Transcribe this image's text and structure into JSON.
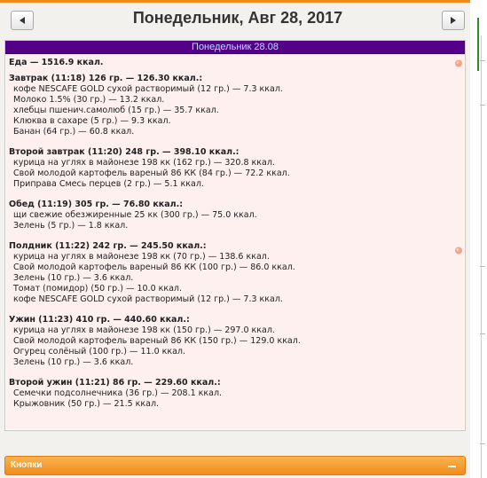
{
  "header": {
    "date_title": "Понедельник, Авг 28, 2017",
    "prev_symbol": "◄",
    "next_symbol": "►"
  },
  "day_header": "Понедельник 28.08",
  "food_total": "Еда — 1516.9 ккал.",
  "meals": [
    {
      "title": "Завтрак (11:18) 126 гр. — 126.30 ккал.:",
      "items": [
        "кофе NESCAFE GOLD сухой растворимый (12 гр.) — 7.3 ккал.",
        "Молоко 1.5% (30 гр.) — 13.2 ккал.",
        "хлебцы пшенич.самолюб (15 гр.) — 35.7 ккал.",
        "Клюква в сахаре (5 гр.) — 9.3 ккал.",
        "Банан (64 гр.) — 60.8 ккал."
      ]
    },
    {
      "title": "Второй завтрак (11:20) 248 гр. — 398.10 ккал.:",
      "items": [
        "курица на углях в майонезе 198 кк (162 гр.) — 320.8 ккал.",
        "Свой молодой картофель вареный 86 КК (84 гр.) — 72.2 ккал.",
        "Приправа Смесь перцев (2 гр.) — 5.1 ккал."
      ]
    },
    {
      "title": "Обед (11:19) 305 гр. — 76.80 ккал.:",
      "items": [
        "щи свежие обезжиренные 25 кк (300 гр.) — 75.0 ккал.",
        "Зелень (5 гр.) — 1.8 ккал."
      ]
    },
    {
      "title": "Полдник (11:22) 242 гр. — 245.50 ккал.:",
      "items": [
        "курица на углях в майонезе 198 кк (70 гр.) — 138.6 ккал.",
        "Свой молодой картофель вареный 86 КК (100 гр.) — 86.0 ккал.",
        "Зелень (10 гр.) — 3.6 ккал.",
        "Томат (помидор) (50 гр.) — 10.0 ккал.",
        "кофе NESCAFE GOLD сухой растворимый (12 гр.) — 7.3 ккал."
      ]
    },
    {
      "title": "Ужин (11:23) 410 гр. — 440.60 ккал.:",
      "items": [
        "курица на углях в майонезе 198 кк (150 гр.) — 297.0 ккал.",
        "Свой молодой картофель вареный 86 КК (150 гр.) — 129.0 ккал.",
        "Огурец солёный (100 гр.) — 11.0 ккал.",
        "Зелень (10 гр.) — 3.6 ккал."
      ]
    },
    {
      "title": "Второй ужин (11:21) 86 гр. — 229.60 ккал.:",
      "items": [
        "Семечки подсолнечника (36 гр.) — 208.1 ккал.",
        "Крыжовник (50 гр.) — 21.5 ккал."
      ]
    }
  ],
  "bottom_bar": {
    "label": "Кнопки"
  },
  "colors": {
    "day_header_bg": "#550088",
    "day_header_text": "#aee0ff",
    "content_bg": "#fdf0ee",
    "bar_orange": "#f08a1a"
  },
  "icons": {
    "prev": "triangle-left-icon",
    "next": "triangle-right-icon",
    "peach": "peach-icon",
    "collapse": "minus-icon"
  }
}
